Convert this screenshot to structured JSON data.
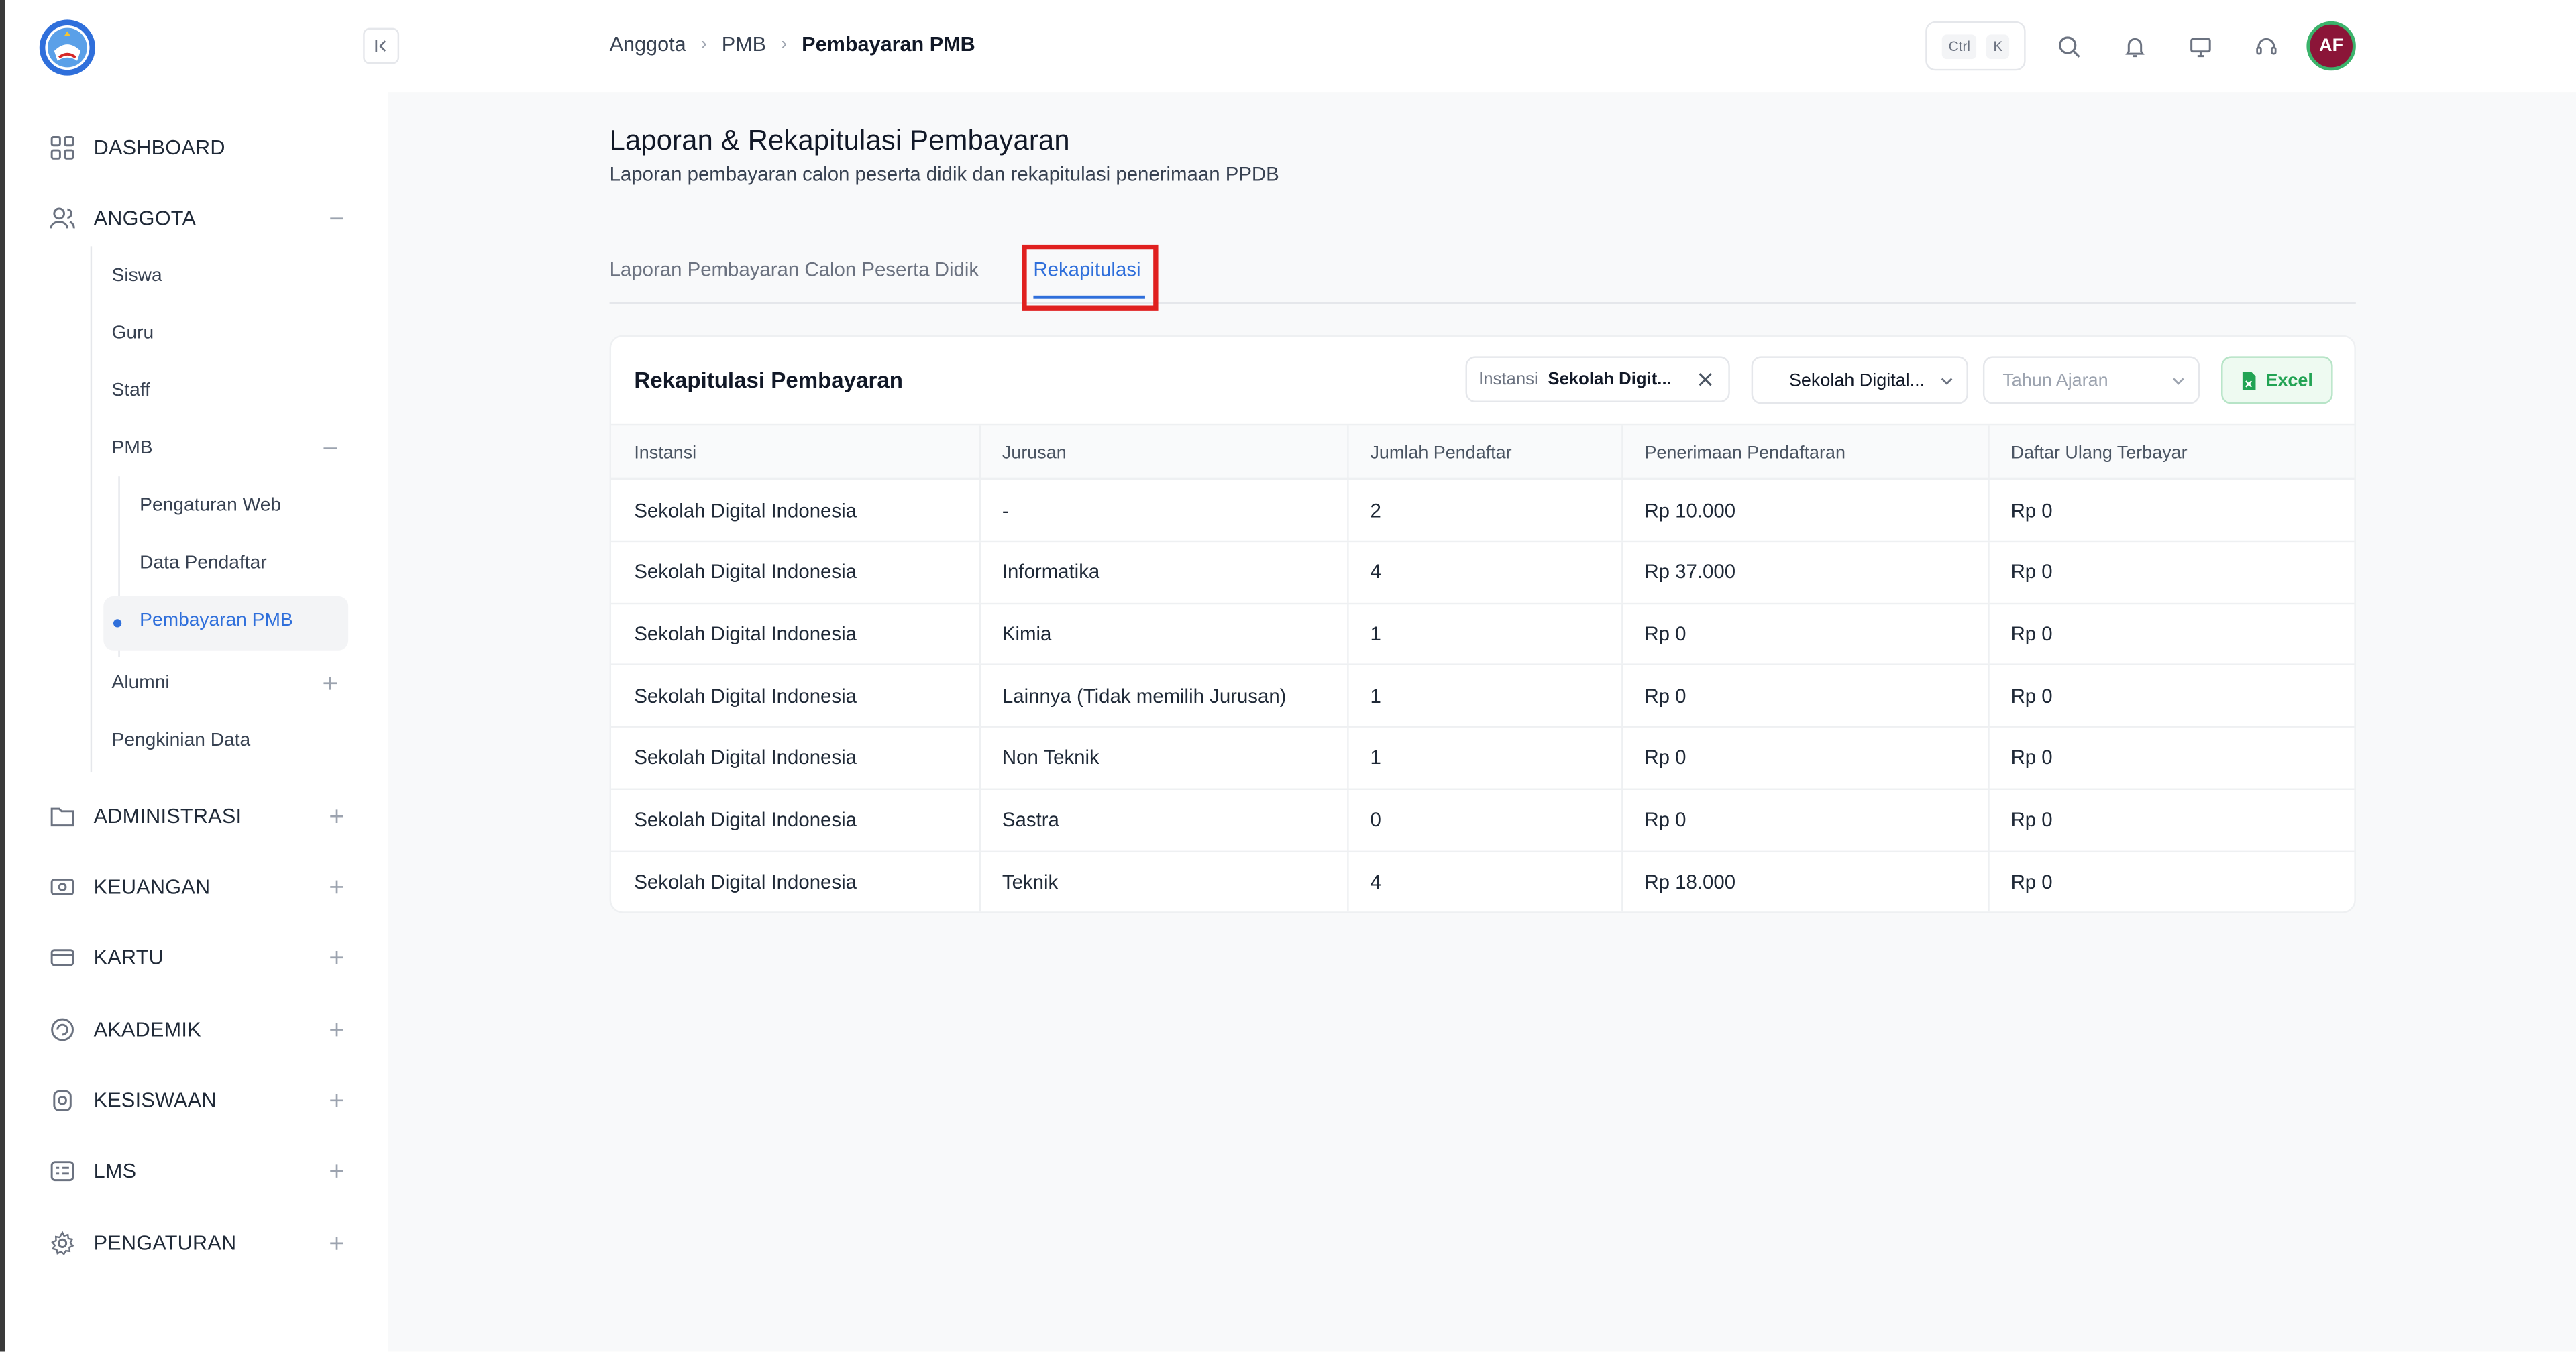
{
  "sidebar": {
    "items": [
      {
        "label": "DASHBOARD",
        "icon": "grid-icon",
        "toggle": "none"
      },
      {
        "label": "ANGGOTA",
        "icon": "users-icon",
        "toggle": "minus"
      },
      {
        "label": "ADMINISTRASI",
        "icon": "folder-icon",
        "toggle": "plus"
      },
      {
        "label": "KEUANGAN",
        "icon": "money-icon",
        "toggle": "plus"
      },
      {
        "label": "KARTU",
        "icon": "card-icon",
        "toggle": "plus"
      },
      {
        "label": "AKADEMIK",
        "icon": "academic-icon",
        "toggle": "plus"
      },
      {
        "label": "KESISWAAN",
        "icon": "student-icon",
        "toggle": "plus"
      },
      {
        "label": "LMS",
        "icon": "lms-icon",
        "toggle": "plus"
      },
      {
        "label": "PENGATURAN",
        "icon": "gear-icon",
        "toggle": "plus"
      }
    ],
    "anggota_sub": [
      {
        "label": "Siswa"
      },
      {
        "label": "Guru"
      },
      {
        "label": "Staff"
      },
      {
        "label": "PMB",
        "toggle": "minus"
      },
      {
        "label": "Alumni",
        "toggle": "plus"
      },
      {
        "label": "Pengkinian Data"
      }
    ],
    "pmb_sub": [
      {
        "label": "Pengaturan Web"
      },
      {
        "label": "Data Pendaftar"
      },
      {
        "label": "Pembayaran PMB",
        "active": true
      }
    ]
  },
  "header": {
    "breadcrumb": [
      "Anggota",
      "PMB",
      "Pembayaran PMB"
    ],
    "shortcut_keys": [
      "Ctrl",
      "K"
    ],
    "avatar_initials": "AF"
  },
  "page": {
    "title": "Laporan & Rekapitulasi Pembayaran",
    "subtitle": "Laporan pembayaran calon peserta didik dan rekapitulasi penerimaan PPDB",
    "tabs": [
      {
        "label": "Laporan Pembayaran Calon Peserta Didik",
        "active": false
      },
      {
        "label": "Rekapitulasi",
        "active": true
      }
    ]
  },
  "card": {
    "title": "Rekapitulasi Pembayaran",
    "filter_chip": {
      "label": "Instansi",
      "value": "Sekolah Digit..."
    },
    "select_instansi": "Sekolah Digital...",
    "select_tahun_placeholder": "Tahun Ajaran",
    "excel_label": "Excel"
  },
  "table": {
    "headers": [
      "Instansi",
      "Jurusan",
      "Jumlah Pendaftar",
      "Penerimaan Pendaftaran",
      "Daftar Ulang Terbayar"
    ],
    "rows": [
      [
        "Sekolah Digital Indonesia",
        "-",
        "2",
        "Rp 10.000",
        "Rp 0"
      ],
      [
        "Sekolah Digital Indonesia",
        "Informatika",
        "4",
        "Rp 37.000",
        "Rp 0"
      ],
      [
        "Sekolah Digital Indonesia",
        "Kimia",
        "1",
        "Rp 0",
        "Rp 0"
      ],
      [
        "Sekolah Digital Indonesia",
        "Lainnya (Tidak memilih Jurusan)",
        "1",
        "Rp 0",
        "Rp 0"
      ],
      [
        "Sekolah Digital Indonesia",
        "Non Teknik",
        "1",
        "Rp 0",
        "Rp 0"
      ],
      [
        "Sekolah Digital Indonesia",
        "Sastra",
        "0",
        "Rp 0",
        "Rp 0"
      ],
      [
        "Sekolah Digital Indonesia",
        "Teknik",
        "4",
        "Rp 18.000",
        "Rp 0"
      ]
    ]
  },
  "colors": {
    "accent": "#2f6fdb",
    "highlight": "#e0201f",
    "excel_green": "#22a354",
    "avatar_bg": "#8b1538"
  }
}
